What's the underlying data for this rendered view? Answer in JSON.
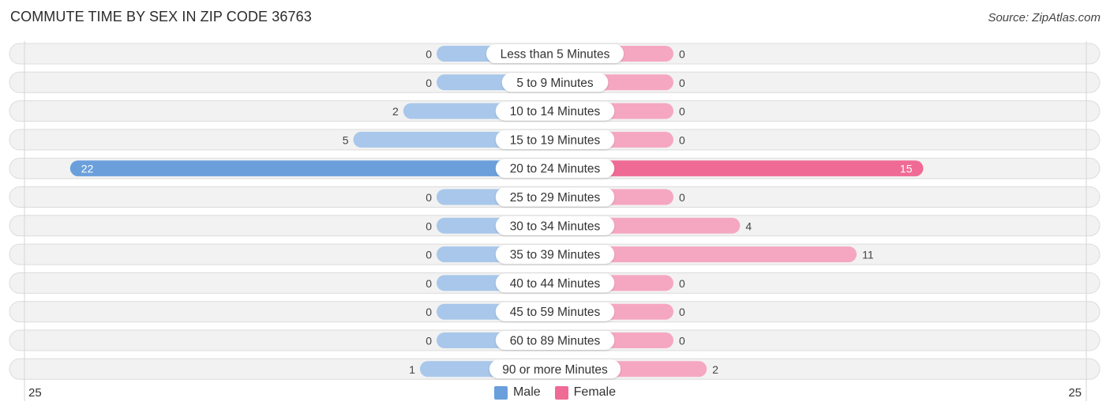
{
  "title": "COMMUTE TIME BY SEX IN ZIP CODE 36763",
  "source": "Source: ZipAtlas.com",
  "colors": {
    "male": "#6a9fdc",
    "male_light": "#a8c7ea",
    "female": "#f06a96",
    "female_light": "#f5a7c1",
    "row_bg": "#f2f2f2",
    "row_border": "#dcdcdc"
  },
  "legend": [
    {
      "label": "Male",
      "color": "#6a9fdc"
    },
    {
      "label": "Female",
      "color": "#f06a96"
    }
  ],
  "axis": {
    "left_label": "25",
    "right_label": "25"
  },
  "chart_data": {
    "type": "bar",
    "orientation": "horizontal-diverging",
    "title": "COMMUTE TIME BY SEX IN ZIP CODE 36763",
    "categories": [
      "Less than 5 Minutes",
      "5 to 9 Minutes",
      "10 to 14 Minutes",
      "15 to 19 Minutes",
      "20 to 24 Minutes",
      "25 to 29 Minutes",
      "30 to 34 Minutes",
      "35 to 39 Minutes",
      "40 to 44 Minutes",
      "45 to 59 Minutes",
      "60 to 89 Minutes",
      "90 or more Minutes"
    ],
    "series": [
      {
        "name": "Male",
        "values": [
          0,
          0,
          2,
          5,
          22,
          0,
          0,
          0,
          0,
          0,
          0,
          1
        ]
      },
      {
        "name": "Female",
        "values": [
          0,
          0,
          0,
          0,
          15,
          0,
          4,
          11,
          0,
          0,
          0,
          2
        ]
      }
    ],
    "xlim": [
      -25,
      25
    ],
    "xtick_labels": [
      "25",
      "25"
    ],
    "legend_position": "bottom-center",
    "grid": false
  }
}
